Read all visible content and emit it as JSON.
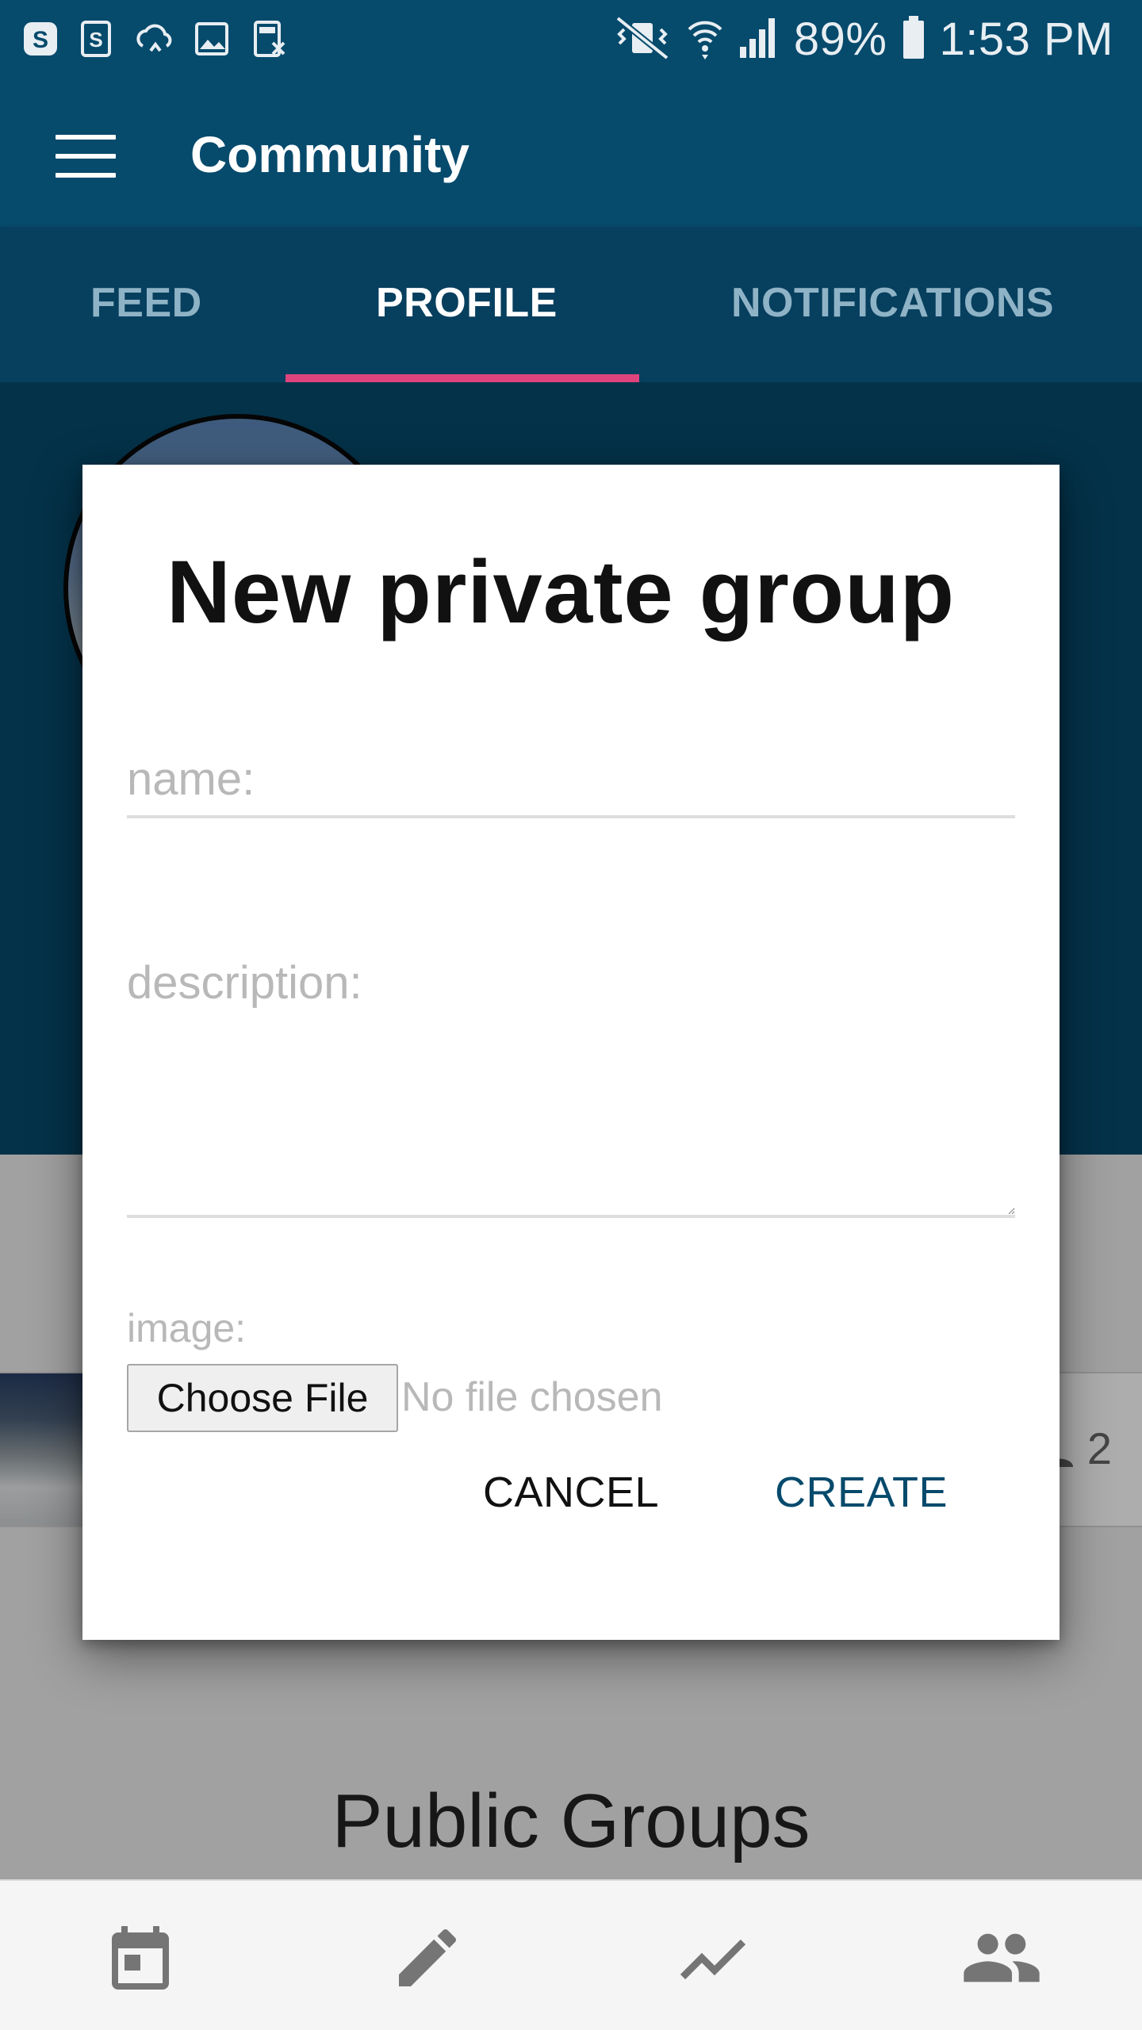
{
  "status_bar": {
    "battery": "89%",
    "time": "1:53 PM",
    "left_icons": [
      "skype-icon",
      "skype-icon",
      "cloud-sync-icon",
      "image-icon",
      "calculator-icon"
    ],
    "right_icons": [
      "vibrate-icon",
      "wifi-icon",
      "signal-icon",
      "battery-icon"
    ]
  },
  "app_bar": {
    "title": "Community",
    "menu_icon": "menu-icon"
  },
  "tabs": [
    {
      "label": "FEED",
      "active": false
    },
    {
      "label": "PROFILE",
      "active": true
    },
    {
      "label": "NOTIFICATIONS",
      "active": false
    }
  ],
  "content": {
    "member_count": "2",
    "public_groups_title": "Public Groups"
  },
  "dialog": {
    "title": "New private group",
    "name_placeholder": "name:",
    "description_placeholder": "description:",
    "image_label": "image:",
    "choose_file_label": "Choose File",
    "no_file_text": "No file chosen",
    "cancel_label": "CANCEL",
    "create_label": "CREATE"
  },
  "bottom_nav": {
    "items": [
      "calendar-icon",
      "pencil-icon",
      "trending-icon",
      "people-icon"
    ]
  },
  "colors": {
    "primary": "#064a6c",
    "tab_indicator": "#e0447d",
    "accent_text": "#064a6c"
  }
}
